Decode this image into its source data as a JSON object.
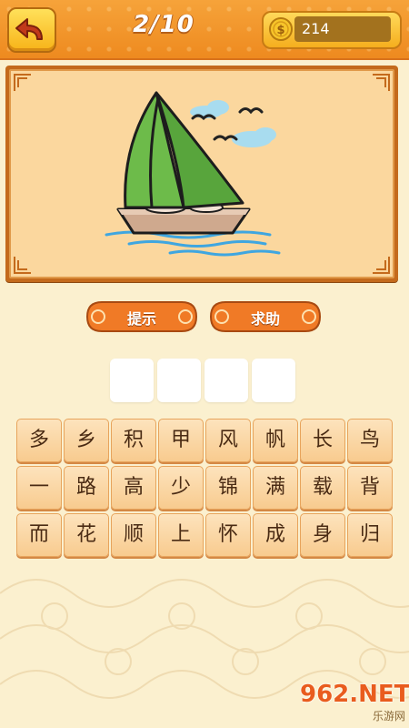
{
  "header": {
    "level": "2/10",
    "coins": "214"
  },
  "actions": {
    "hint_label": "提示",
    "help_label": "求助"
  },
  "answer_slots": [
    "",
    "",
    "",
    ""
  ],
  "characters": [
    [
      "多",
      "乡",
      "积",
      "甲",
      "风",
      "帆",
      "长",
      "鸟"
    ],
    [
      "一",
      "路",
      "高",
      "少",
      "锦",
      "满",
      "载",
      "背"
    ],
    [
      "而",
      "花",
      "顺",
      "上",
      "怀",
      "成",
      "身",
      "归"
    ]
  ],
  "watermark": {
    "brand": "962.NET",
    "sub": "乐游网"
  },
  "icons": {
    "back": "undo-arrow-icon",
    "coin": "dollar-coin-icon"
  },
  "colors": {
    "header_orange": "#ee8a1f",
    "button_yellow": "#f7b318",
    "frame_brown": "#c46a1c",
    "tile_fill": "#f8cb8f",
    "sail_green": "#6dbb4a"
  }
}
